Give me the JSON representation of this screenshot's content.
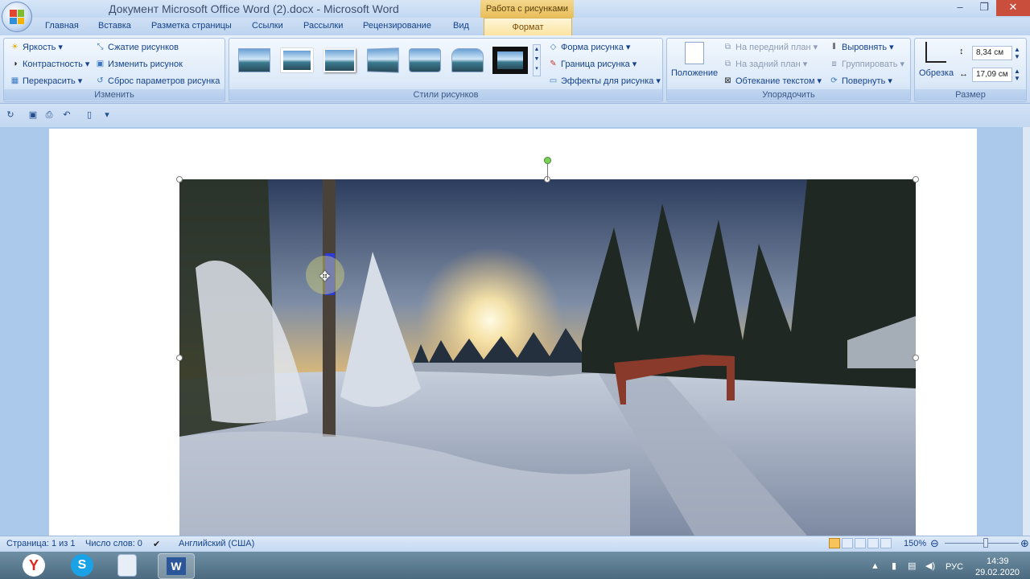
{
  "window": {
    "title": "Документ Microsoft Office Word (2).docx - Microsoft Word",
    "context_tab_title": "Работа с рисунками",
    "minimize": "–",
    "restore": "❐",
    "close": "✕"
  },
  "tabs": [
    "Главная",
    "Вставка",
    "Разметка страницы",
    "Ссылки",
    "Рассылки",
    "Рецензирование",
    "Вид",
    "Формат"
  ],
  "ribbon": {
    "adjust": {
      "label": "Изменить",
      "brightness": "Яркость",
      "contrast": "Контрастность",
      "recolor": "Перекрасить",
      "compress": "Сжатие рисунков",
      "change": "Изменить рисунок",
      "reset": "Сброс параметров рисунка"
    },
    "styles": {
      "label": "Стили рисунков",
      "shape": "Форма рисунка",
      "border": "Граница рисунка",
      "effects": "Эффекты для рисунка"
    },
    "arrange": {
      "label": "Упорядочить",
      "position": "Положение",
      "bring_front": "На передний план",
      "send_back": "На задний план",
      "wrap": "Обтекание текстом",
      "align": "Выровнять",
      "group": "Группировать",
      "rotate": "Повернуть"
    },
    "size": {
      "label": "Размер",
      "crop": "Обрезка",
      "height": "8,34 см",
      "width": "17,09 см"
    }
  },
  "status": {
    "page": "Страница: 1 из 1",
    "words": "Число слов: 0",
    "language": "Английский (США)",
    "zoom": "150%"
  },
  "tray": {
    "lang": "РУС",
    "time": "14:39",
    "date": "29.02.2020"
  },
  "colors": {
    "accent": "#15428b",
    "context_tab": "#e9be5a",
    "close": "#c94e3c"
  }
}
